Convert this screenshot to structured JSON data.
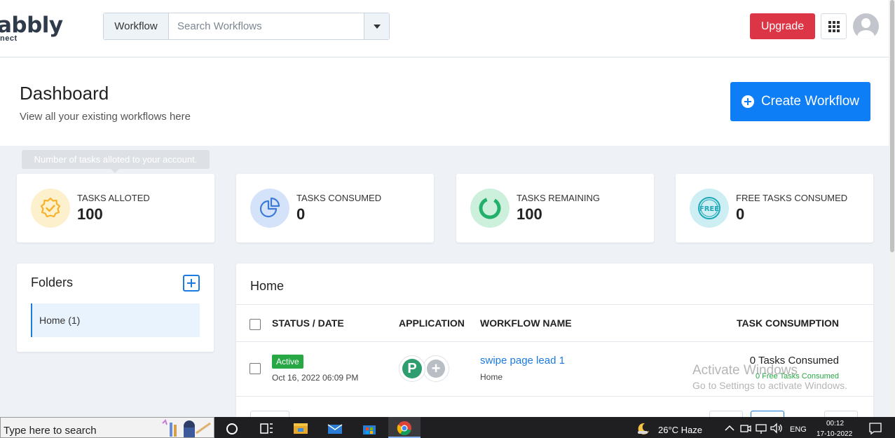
{
  "brand": {
    "logo_text": "abbly",
    "logo_sub": "nect"
  },
  "topbar": {
    "search_prefix": "Workflow",
    "search_placeholder": "Search Workflows",
    "upgrade_label": "Upgrade"
  },
  "header": {
    "title": "Dashboard",
    "subtitle": "View all your existing workflows here",
    "create_label": "Create Workflow"
  },
  "tooltip": "Number of tasks alloted to your account.",
  "stats": [
    {
      "label": "TASKS ALLOTED",
      "value": "100",
      "color": "#f6c142",
      "bg": "#fdf0cc"
    },
    {
      "label": "TASKS CONSUMED",
      "value": "0",
      "color": "#3d7ad6",
      "bg": "#d4e3fa"
    },
    {
      "label": "TASKS REMAINING",
      "value": "100",
      "color": "#22b06a",
      "bg": "#cdf0dd"
    },
    {
      "label": "FREE TASKS CONSUMED",
      "value": "0",
      "color": "#1fa8b8",
      "bg": "#cdeef2"
    }
  ],
  "folders": {
    "title": "Folders",
    "items": [
      {
        "label": "Home (1)"
      }
    ]
  },
  "main": {
    "title": "Home",
    "columns": [
      "STATUS / DATE",
      "APPLICATION",
      "WORKFLOW NAME",
      "TASK CONSUMPTION"
    ],
    "rows": [
      {
        "status": "Active",
        "date": "Oct 16, 2022 06:09 PM",
        "app_letter": "P",
        "workflow_name": "swipe page lead 1",
        "folder": "Home",
        "tasks_consumed": "0 Tasks Consumed",
        "free_tasks": "0 Free Tasks Consumed"
      }
    ]
  },
  "watermark": {
    "line1": "Activate Windows",
    "line2": "Go to Settings to activate Windows."
  },
  "taskbar": {
    "search_text": "Type here to search",
    "weather": "26°C  Haze",
    "lang": "ENG",
    "time": "00:12",
    "date": "17-10-2022"
  },
  "colors": {
    "upgrade": "#dc3545",
    "primary": "#0d7ef5",
    "active_badge": "#28a745"
  }
}
